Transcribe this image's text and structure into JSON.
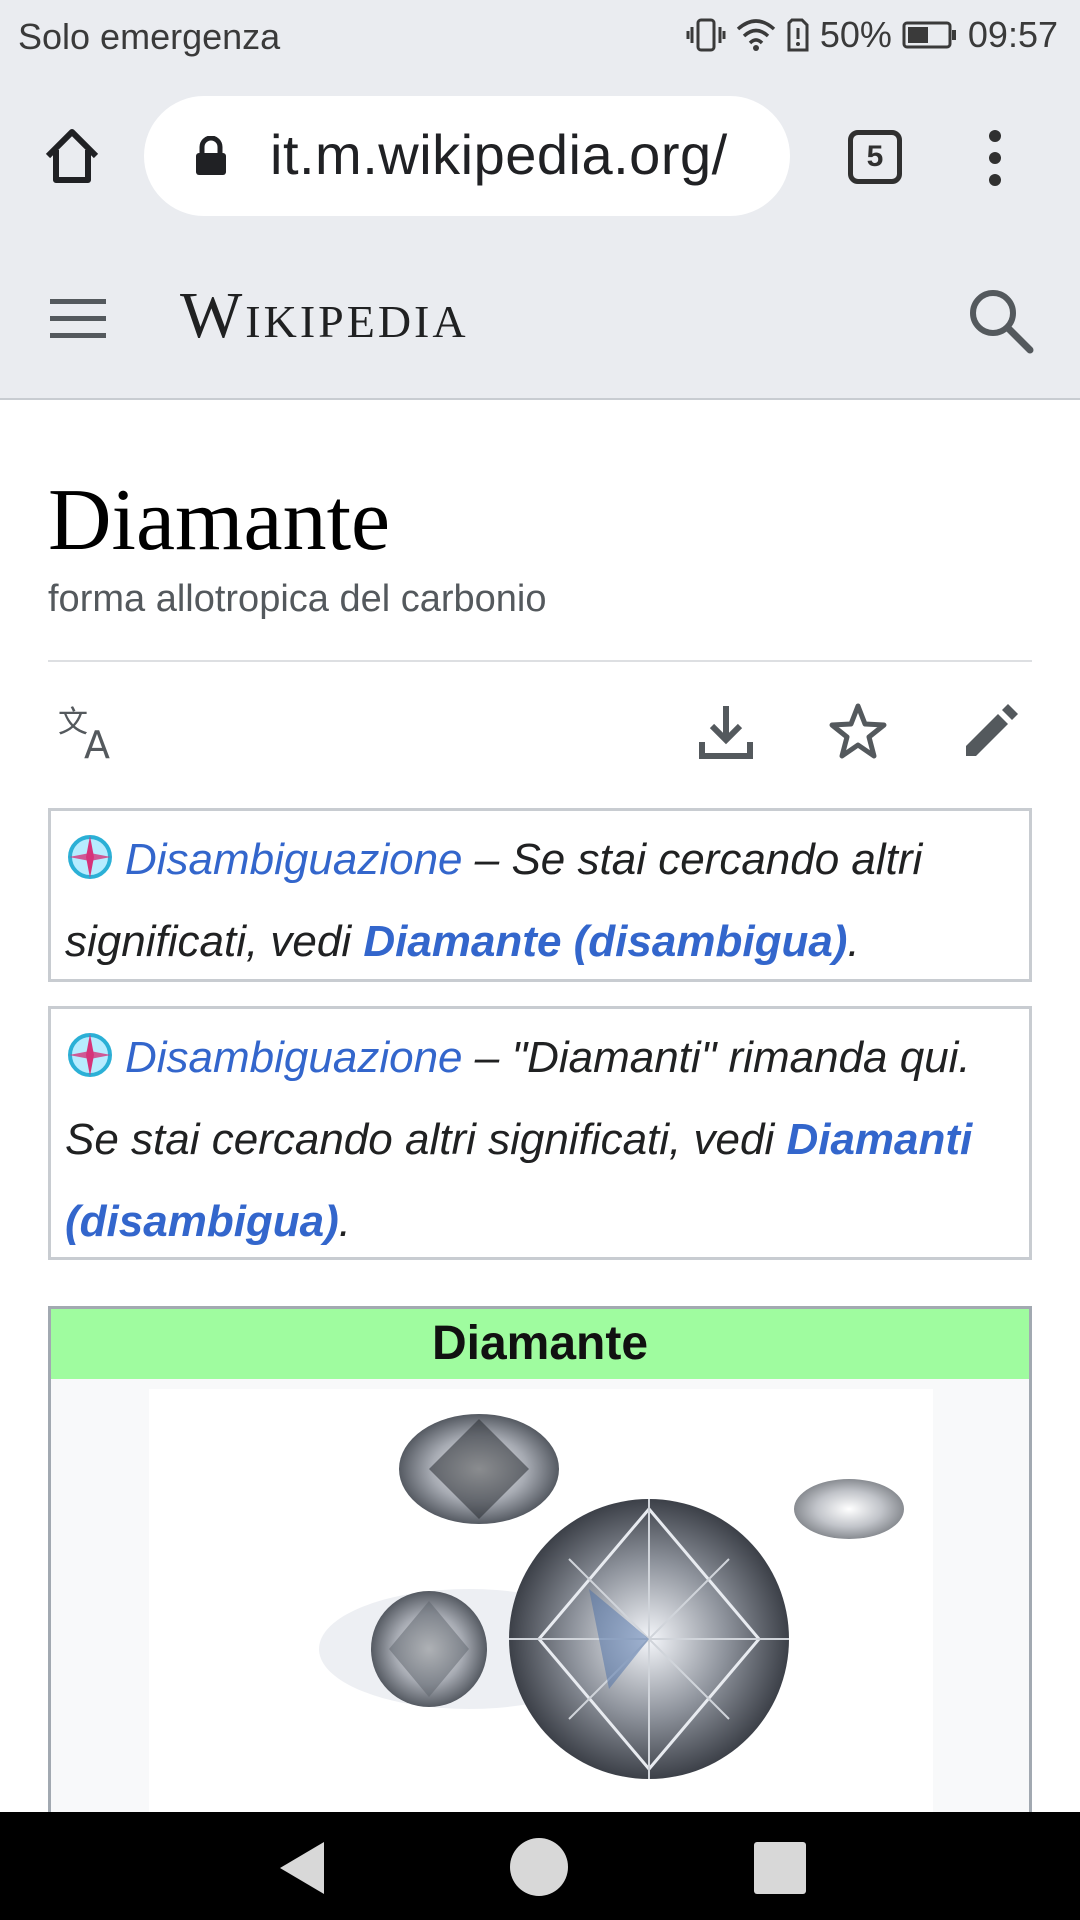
{
  "status_bar": {
    "carrier": "Solo emergenza",
    "battery": "50%",
    "time": "09:57"
  },
  "browser": {
    "url": "it.m.wikipedia.org/",
    "tab_count": "5"
  },
  "wiki_header": {
    "logo": "Wikipedia"
  },
  "page": {
    "title": "Diamante",
    "subtitle": "forma allotropica del carbonio"
  },
  "notices": [
    {
      "link": "Disambiguazione",
      "text1": " – Se stai cercando altri significati, vedi ",
      "bold_link": "Diamante (disambigua)",
      "text2": "."
    },
    {
      "link": "Disambiguazione",
      "text1": " – \"Diamanti\" rimanda qui. Se stai cercando altri significati, vedi ",
      "bold_link": "Diamanti (disambigua)",
      "text2": "."
    }
  ],
  "infobox": {
    "title": "Diamante",
    "header_color": "#9ffc9f"
  },
  "colors": {
    "link": "#3366cc",
    "chrome_bg": "#eaecf0"
  },
  "icons": [
    "home-icon",
    "lock-icon",
    "tabs-icon",
    "menu-icon",
    "hamburger-icon",
    "search-icon",
    "translate-icon",
    "download-icon",
    "star-icon",
    "edit-icon",
    "compass-icon"
  ]
}
